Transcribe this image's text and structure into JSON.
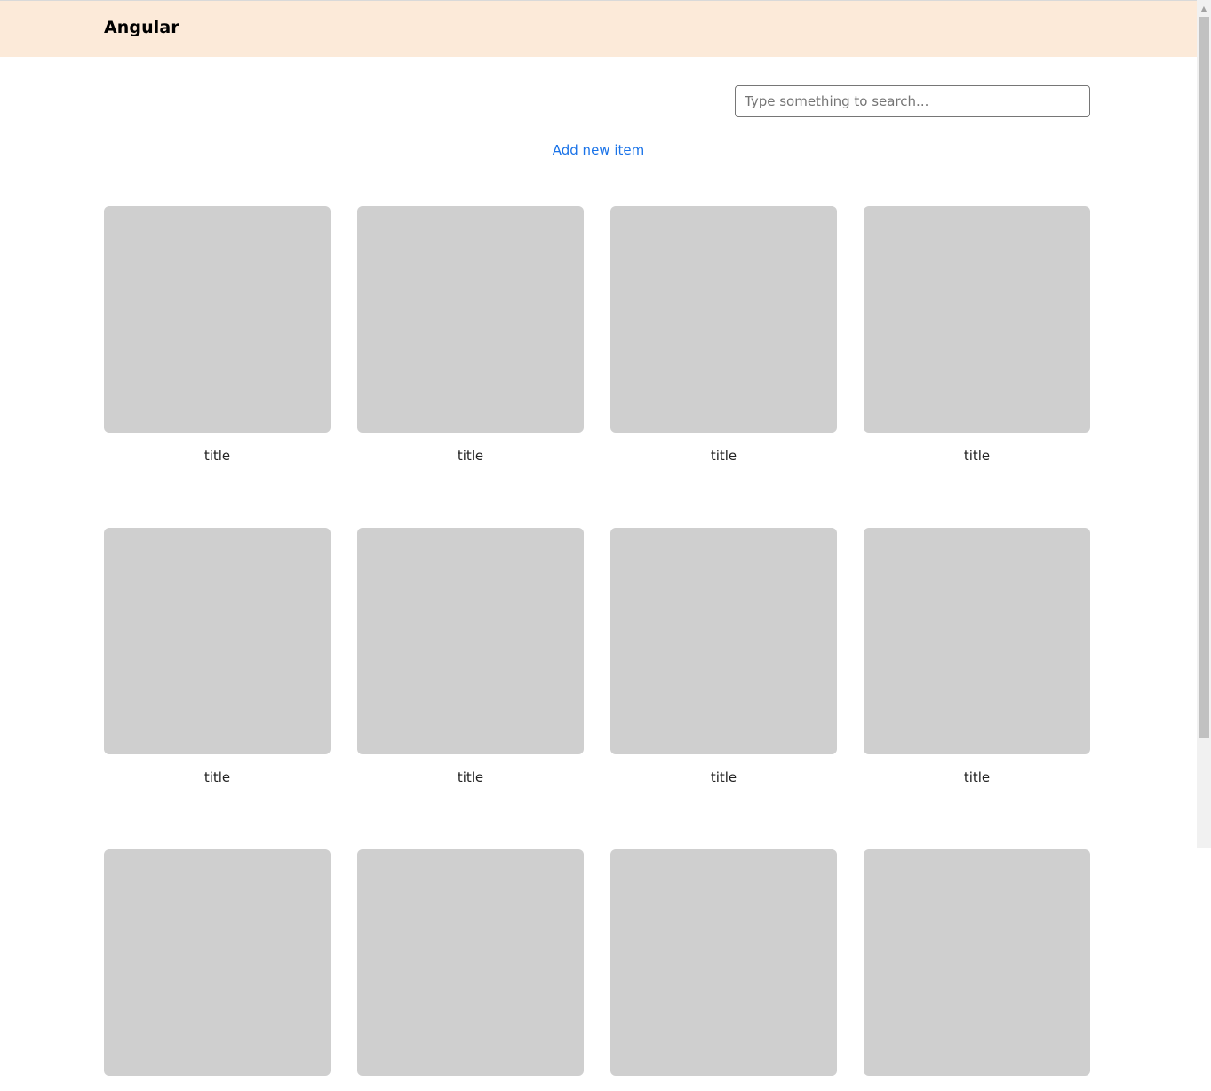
{
  "header": {
    "brand": "Angular"
  },
  "search": {
    "placeholder": "Type something to search..."
  },
  "actions": {
    "add_new_label": "Add new item"
  },
  "items": [
    {
      "title": "title"
    },
    {
      "title": "title"
    },
    {
      "title": "title"
    },
    {
      "title": "title"
    },
    {
      "title": "title"
    },
    {
      "title": "title"
    },
    {
      "title": "title"
    },
    {
      "title": "title"
    },
    {
      "title": ""
    },
    {
      "title": ""
    },
    {
      "title": ""
    },
    {
      "title": ""
    }
  ],
  "icons": {
    "scroll_up": "scroll-up-arrow-icon"
  },
  "colors": {
    "header_bg": "#fcead9",
    "link": "#1a73e8",
    "placeholder_thumb": "#cfcfcf"
  }
}
